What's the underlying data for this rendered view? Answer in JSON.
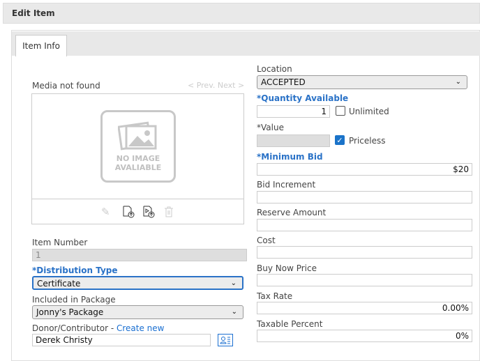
{
  "header": {
    "title": "Edit Item"
  },
  "tabs": [
    {
      "label": "Item Info"
    }
  ],
  "media": {
    "status": "Media not found",
    "nav": "< Prev. Next >",
    "placeholder_line1": "NO IMAGE",
    "placeholder_line2": "AVALIABLE"
  },
  "left": {
    "item_number": {
      "label": "Item Number",
      "value": "1"
    },
    "distribution_type": {
      "label": "*Distribution Type",
      "value": "Certificate"
    },
    "package": {
      "label": "Included in Package",
      "value": "Jonny's Package"
    },
    "donor": {
      "label": "Donor/Contributor - ",
      "link": "Create new",
      "value": "Derek Christy"
    }
  },
  "right": {
    "location": {
      "label": "Location",
      "value": "ACCEPTED"
    },
    "quantity": {
      "label": "*Quantity Available",
      "value": "1",
      "unlimited_label": "Unlimited",
      "unlimited": false
    },
    "value": {
      "label": "*Value",
      "value": "",
      "priceless_label": "Priceless",
      "priceless": true
    },
    "min_bid": {
      "label": "*Minimum Bid",
      "value": "$20"
    },
    "bid_increment": {
      "label": "Bid Increment",
      "value": ""
    },
    "reserve": {
      "label": "Reserve Amount",
      "value": ""
    },
    "cost": {
      "label": "Cost",
      "value": ""
    },
    "buy_now": {
      "label": "Buy Now Price",
      "value": ""
    },
    "tax_rate": {
      "label": "Tax Rate",
      "value": "0.00%"
    },
    "taxable_percent": {
      "label": "Taxable Percent",
      "value": "0%"
    }
  }
}
